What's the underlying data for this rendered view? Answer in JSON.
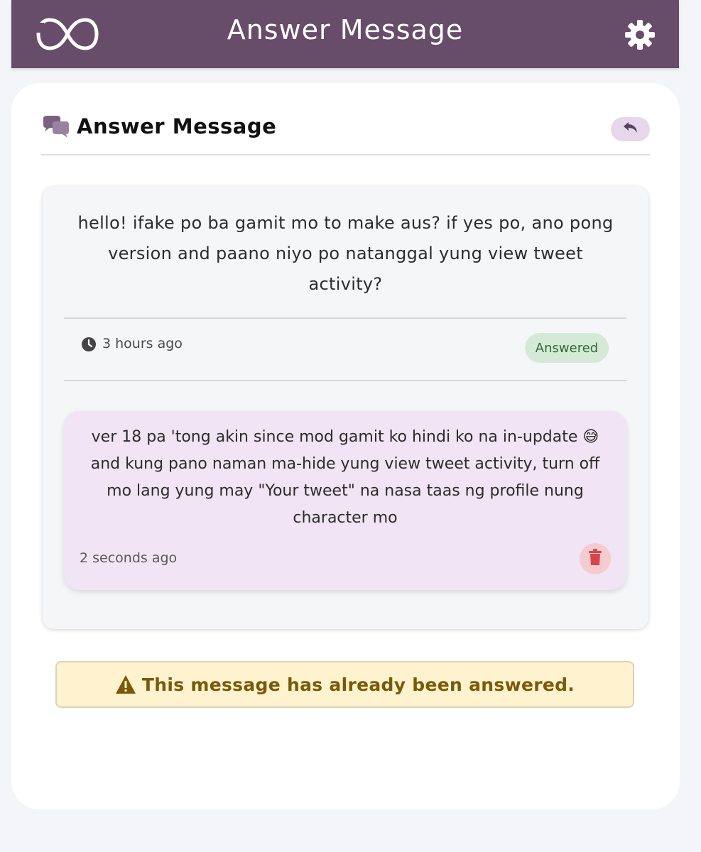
{
  "app_bar": {
    "title": "Answer Message",
    "logo_icon": "infinity-logo-icon",
    "settings_icon": "gear-icon",
    "color": "#674d6a"
  },
  "card": {
    "header_icon": "comments-icon",
    "title": "Answer Message",
    "back_icon": "reply-arrow-icon"
  },
  "message": {
    "text": "hello! ifake po ba gamit mo to make aus? if yes po, ano pong version and paano niyo po natanggal yung view tweet activity?",
    "time_icon": "clock-icon",
    "time": "3 hours ago",
    "status": "Answered",
    "status_color": "#d4ead7"
  },
  "answer": {
    "text": "ver 18 pa 'tong akin since mod gamit ko hindi ko na in-update 😅 and kung pano naman ma-hide yung view tweet activity, turn off mo lang yung may \"Your tweet\" na nasa taas ng profile nung character mo",
    "time": "2 seconds ago",
    "delete_icon": "trash-icon",
    "bubble_color": "#f1e4f4"
  },
  "alert": {
    "icon": "warning-icon",
    "text": "This message has already been answered.",
    "color": "#fff2cf"
  }
}
